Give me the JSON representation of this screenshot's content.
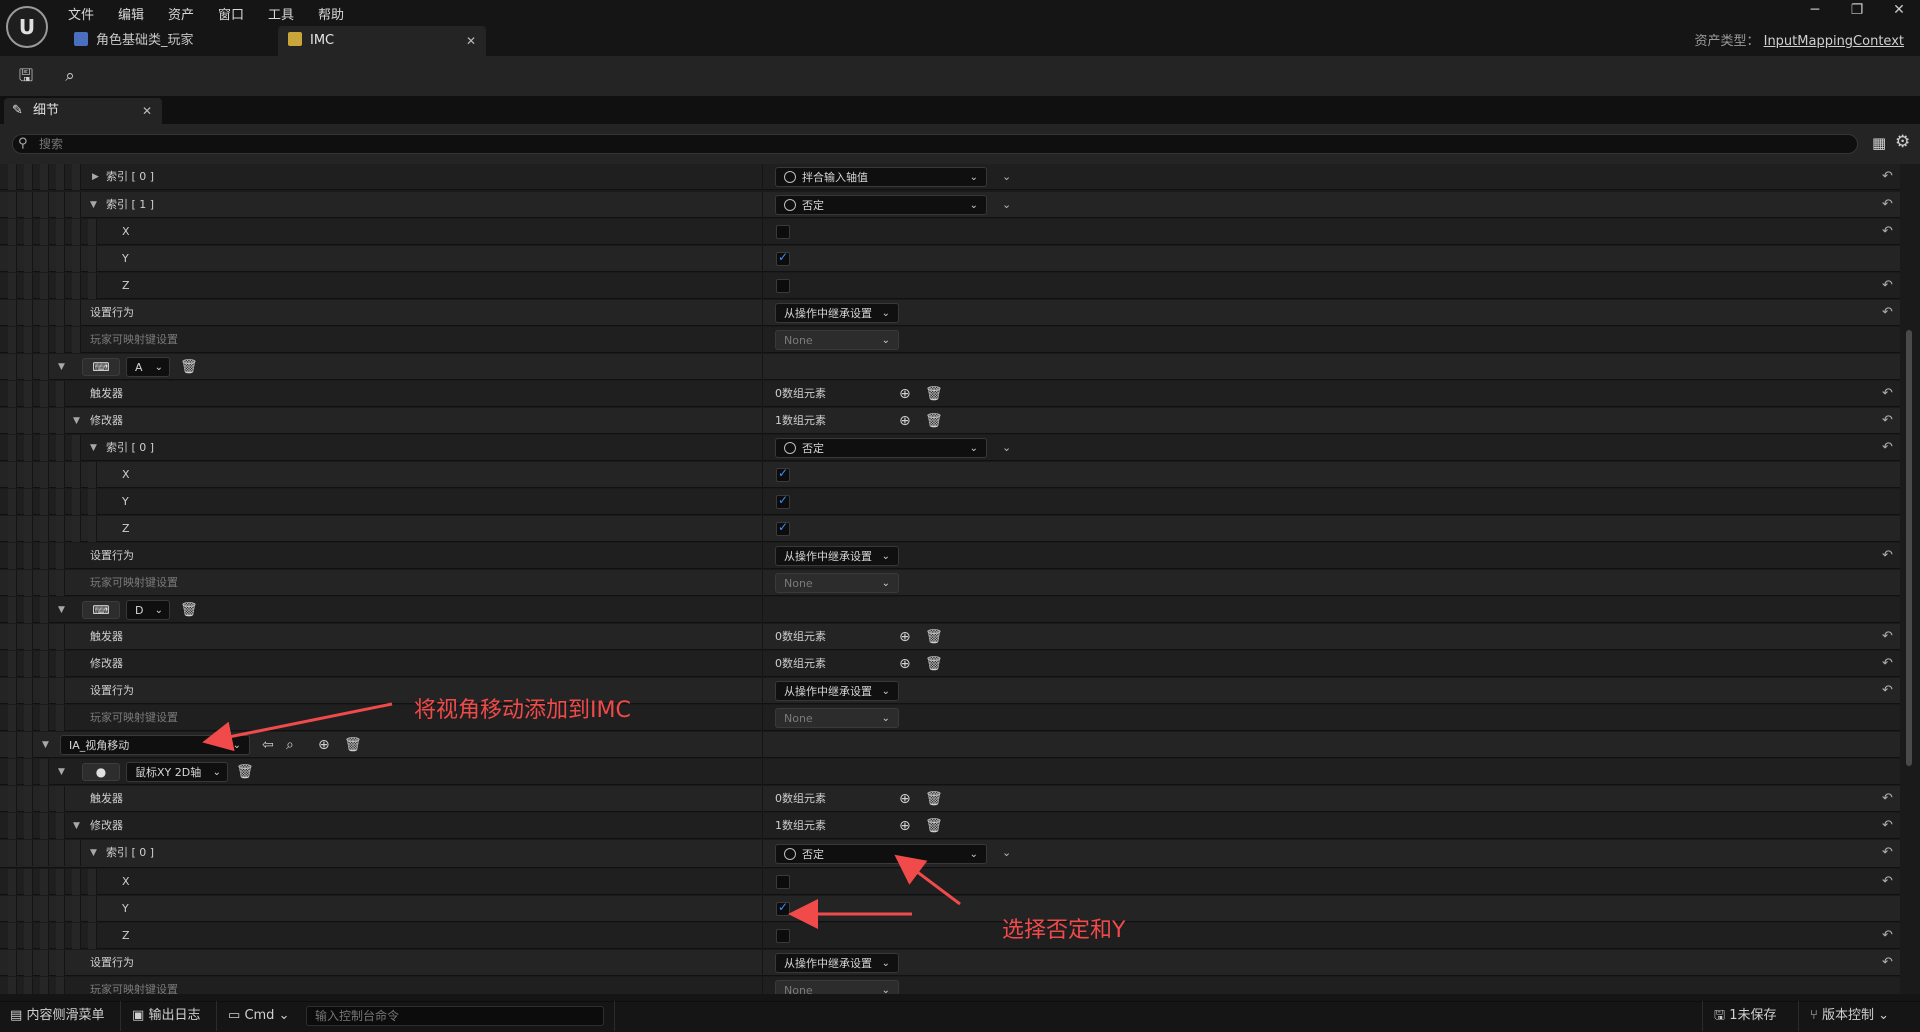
{
  "menu": [
    "文件",
    "编辑",
    "资产",
    "窗口",
    "工具",
    "帮助"
  ],
  "tabs": [
    {
      "label": "角色基础类_玩家"
    },
    {
      "label": "IMC"
    }
  ],
  "asset_type": {
    "label": "资产类型：",
    "value": "InputMappingContext"
  },
  "details_tab": {
    "label": "细节"
  },
  "search": {
    "placeholder": "搜索"
  },
  "labels": {
    "index0": "索引 [ 0 ]",
    "index1": "索引 [ 1 ]",
    "x": "X",
    "y": "Y",
    "z": "Z",
    "set_behavior": "设置行为",
    "player_mappable": "玩家可映射键设置",
    "triggers": "触发器",
    "modifiers": "修改器",
    "zero_elements": "0数组元素",
    "one_element": "1数组元素",
    "swizzle": "拌合输入轴值",
    "negate": "否定",
    "inherit": "从操作中继承设置",
    "none": "None",
    "key_a": "A",
    "key_d": "D",
    "mouse_xy": "鼠标XY 2D轴",
    "action": "IA_视角移动"
  },
  "checkboxes": {
    "block1": {
      "x": false,
      "y": true,
      "z": false
    },
    "block_a": {
      "x": true,
      "y": true,
      "z": true
    },
    "block_mouse": {
      "x": false,
      "y": true,
      "z": false
    }
  },
  "annotations": {
    "add_to_imc": "将视角移动添加到IMC",
    "choose_negate_y": "选择否定和Y",
    "color": "#f04a4a"
  },
  "statusbar": {
    "content_drawer": "内容侧滑菜单",
    "output_log": "输出日志",
    "cmd": "Cmd",
    "console_placeholder": "输入控制台命令",
    "unsaved": "1未保存",
    "source_control": "版本控制"
  }
}
